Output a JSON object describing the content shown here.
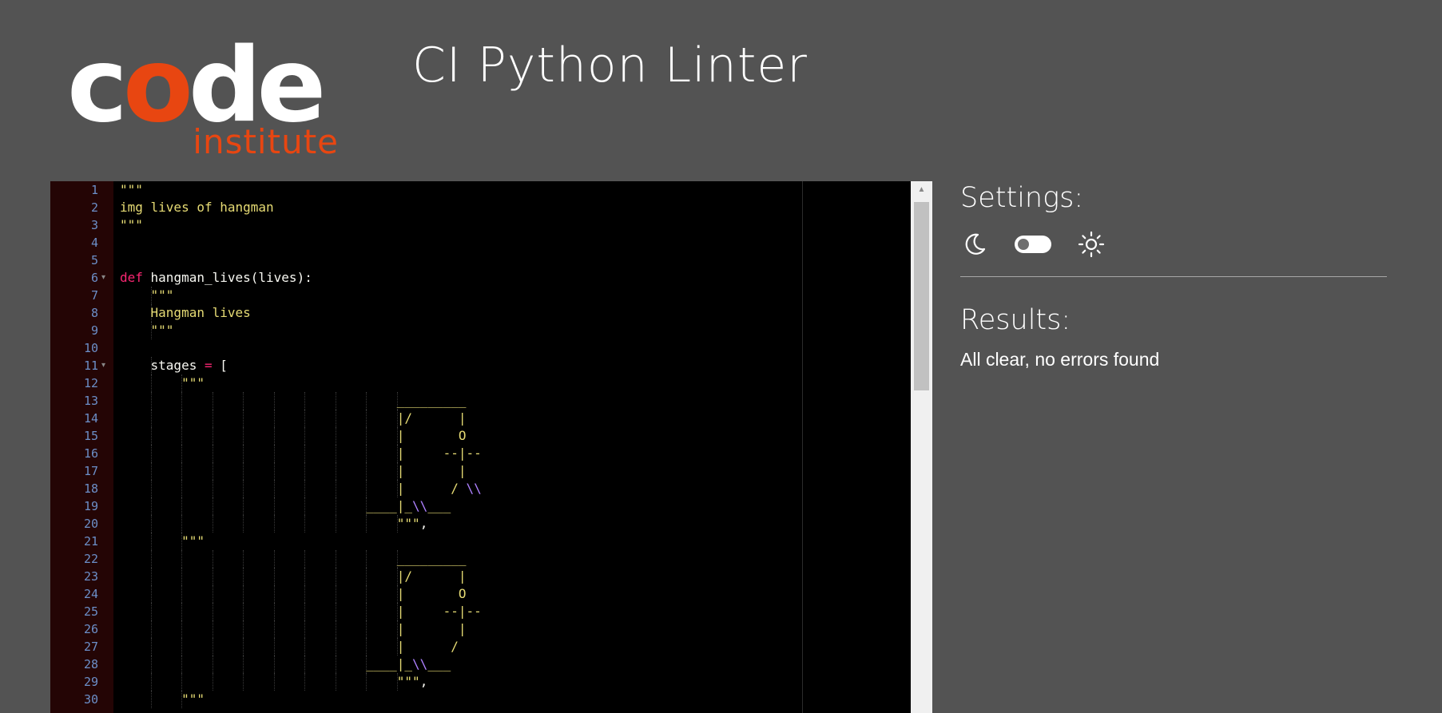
{
  "header": {
    "logo_prefix": "c",
    "logo_accent": "o",
    "logo_suffix": "de",
    "logo_sub": "institute",
    "title": "CI Python Linter"
  },
  "editor": {
    "lines": [
      {
        "n": "1",
        "text": "\"\"\""
      },
      {
        "n": "2",
        "text": "img lives of hangman"
      },
      {
        "n": "3",
        "text": "\"\"\""
      },
      {
        "n": "4",
        "text": ""
      },
      {
        "n": "5",
        "text": ""
      },
      {
        "n": "6",
        "text": "def hangman_lives(lives):",
        "fold": true
      },
      {
        "n": "7",
        "text": "    \"\"\""
      },
      {
        "n": "8",
        "text": "    Hangman lives"
      },
      {
        "n": "9",
        "text": "    \"\"\""
      },
      {
        "n": "10",
        "text": ""
      },
      {
        "n": "11",
        "text": "    stages = [",
        "fold": true
      },
      {
        "n": "12",
        "text": "        \"\"\""
      },
      {
        "n": "13",
        "text": "                                    _________"
      },
      {
        "n": "14",
        "text": "                                    |/      |"
      },
      {
        "n": "15",
        "text": "                                    |       O"
      },
      {
        "n": "16",
        "text": "                                    |     --|--"
      },
      {
        "n": "17",
        "text": "                                    |       |"
      },
      {
        "n": "18",
        "text": "                                    |      / \\\\"
      },
      {
        "n": "19",
        "text": "                                ____|_\\\\___"
      },
      {
        "n": "20",
        "text": "                                    \"\"\","
      },
      {
        "n": "21",
        "text": "        \"\"\""
      },
      {
        "n": "22",
        "text": "                                    _________"
      },
      {
        "n": "23",
        "text": "                                    |/      |"
      },
      {
        "n": "24",
        "text": "                                    |       O"
      },
      {
        "n": "25",
        "text": "                                    |     --|--"
      },
      {
        "n": "26",
        "text": "                                    |       |"
      },
      {
        "n": "27",
        "text": "                                    |      /"
      },
      {
        "n": "28",
        "text": "                                ____|_\\\\___"
      },
      {
        "n": "29",
        "text": "                                    \"\"\","
      },
      {
        "n": "30",
        "text": "        \"\"\""
      }
    ]
  },
  "settings": {
    "title": "Settings:",
    "dark_icon": "moon-icon",
    "light_icon": "sun-icon",
    "toggle_state": "off"
  },
  "results": {
    "title": "Results:",
    "message": "All clear, no errors found"
  },
  "colors": {
    "background": "#535353",
    "editor_bg": "#000000",
    "gutter_bg": "#240505",
    "brand_accent": "#e84611",
    "string": "#e6db74",
    "keyword": "#f92672",
    "escape": "#ae81ff",
    "line_number": "#6c8fc8"
  }
}
